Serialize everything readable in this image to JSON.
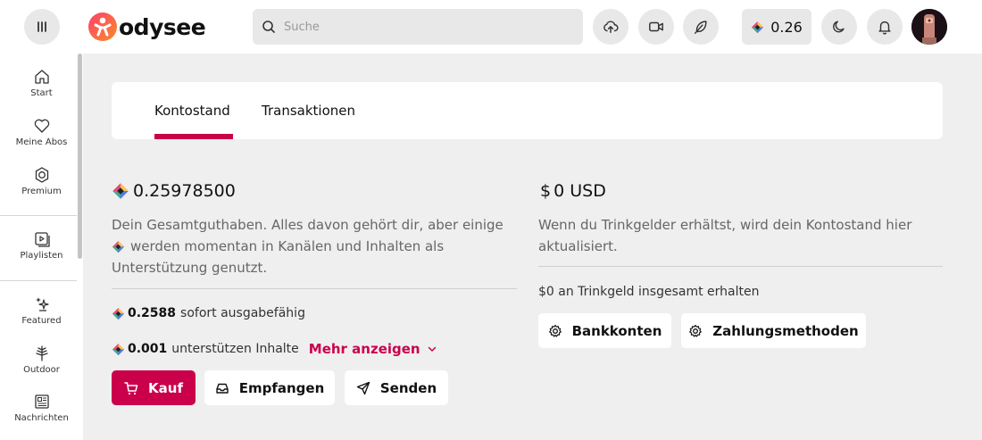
{
  "header": {
    "logo_text": "odysee",
    "search_placeholder": "Suche",
    "credits_value": "0.26",
    "icons": [
      "menu-icon",
      "upload-icon",
      "video-camera-icon",
      "feather-icon",
      "moon-icon",
      "bell-icon"
    ]
  },
  "sidebar": {
    "items": [
      {
        "label": "Start",
        "icon": "home-icon"
      },
      {
        "label": "Meine Abos",
        "icon": "heart-icon"
      },
      {
        "label": "Premium",
        "icon": "premium-badge-icon"
      },
      {
        "label": "Playlisten",
        "icon": "playlist-icon"
      },
      {
        "label": "Featured",
        "icon": "sparkle-icon"
      },
      {
        "label": "Outdoor",
        "icon": "tree-icon"
      },
      {
        "label": "Nachrichten",
        "icon": "newspaper-icon"
      }
    ]
  },
  "tabs": [
    {
      "label": "Kontostand",
      "active": true
    },
    {
      "label": "Transaktionen",
      "active": false
    }
  ],
  "balance": {
    "amount": "0.25978500",
    "desc_part1": "Dein Gesamtguthaben. Alles davon gehört dir, aber einige",
    "desc_part2": "werden momentan in Kanälen und Inhalten als",
    "desc_part3": "Unterstützung genutzt.",
    "spendable_value": "0.2588",
    "spendable_label": "sofort ausgabefähig",
    "support_value": "0.001",
    "support_label": "unterstützen Inhalte",
    "show_more": "Mehr anzeigen",
    "buttons": {
      "buy": "Kauf",
      "receive": "Empfangen",
      "send": "Senden"
    }
  },
  "usd": {
    "amount": "0 USD",
    "currency_symbol": "$",
    "desc_part1": "Wenn du Trinkgelder erhältst, wird dein Kontostand hier",
    "desc_part2": "aktualisiert.",
    "tips_total": "$0 an Trinkgeld insgesamt erhalten",
    "buttons": {
      "bank": "Bankkonten",
      "payment": "Zahlungsmethoden"
    }
  },
  "colors": {
    "accent": "#ca004b",
    "background": "#efefef",
    "card": "#ffffff"
  }
}
